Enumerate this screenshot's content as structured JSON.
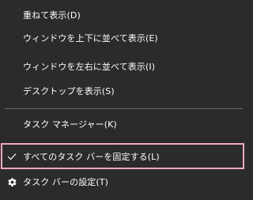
{
  "menu": {
    "items": [
      {
        "label": "重ねて表示(D)"
      },
      {
        "label": "ウィンドウを上下に並べて表示(E)"
      },
      {
        "label": "ウィンドウを左右に並べて表示(I)"
      },
      {
        "label": "デスクトップを表示(S)"
      },
      {
        "label": "タスク マネージャー(K)"
      },
      {
        "label": "すべてのタスク バーを固定する(L)",
        "checked": true
      },
      {
        "label": "タスク バーの設定(T)",
        "icon": "gear-icon"
      }
    ]
  },
  "colors": {
    "background": "#2b2b2b",
    "text": "#ffffff",
    "separator": "#6b6b6b",
    "highlight_border": "#f2a7c3"
  }
}
